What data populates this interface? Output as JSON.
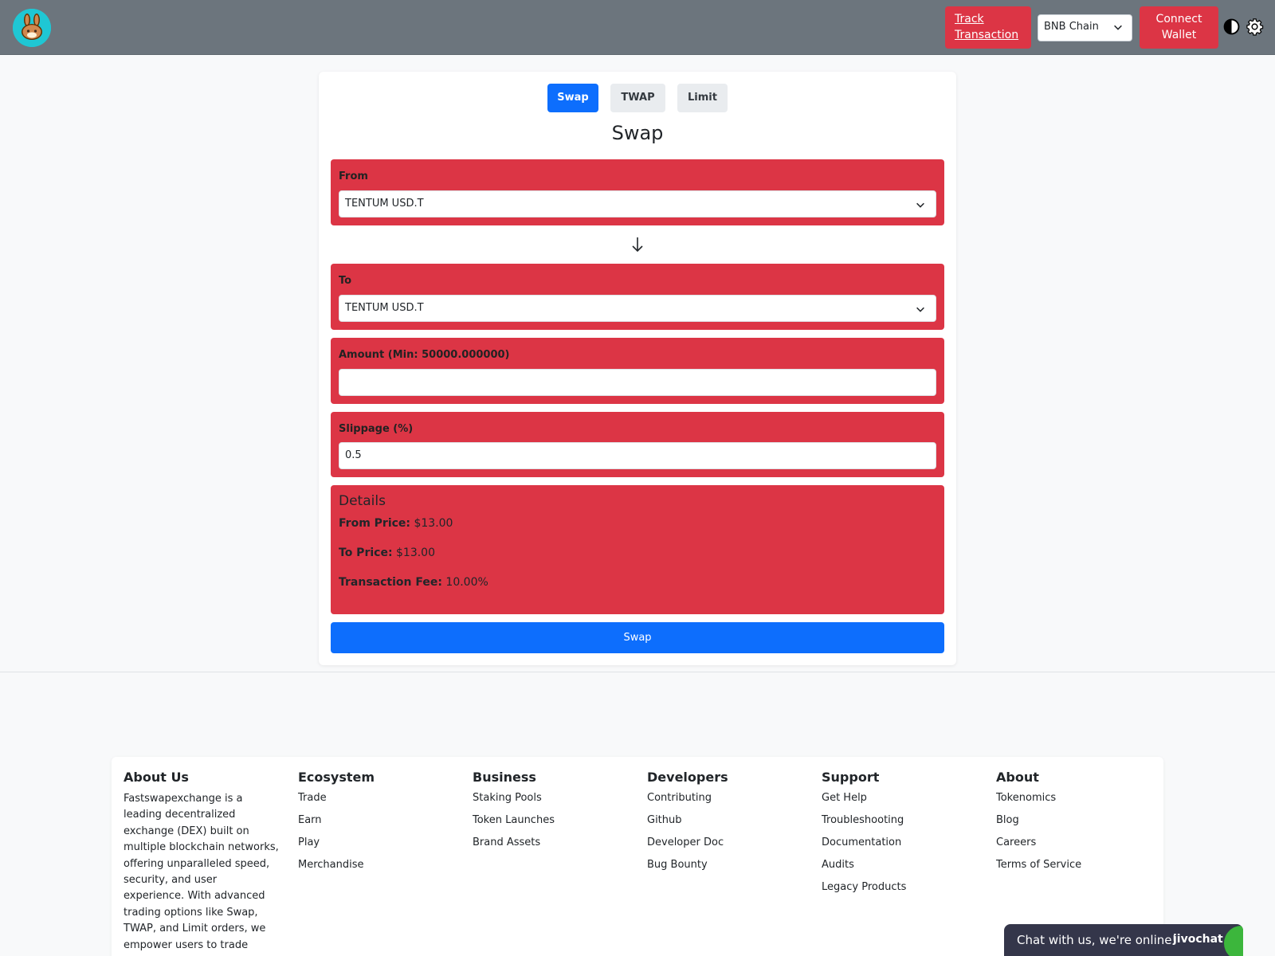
{
  "header": {
    "track_line1": "Track",
    "track_line2": "Transaction",
    "chain_selected": "BNB Chain",
    "connect_line1": "Connect",
    "connect_line2": "Wallet"
  },
  "tabs": {
    "swap": "Swap",
    "twap": "TWAP",
    "limit": "Limit"
  },
  "swap": {
    "title": "Swap",
    "from_label": "From",
    "from_value": "TENTUM USD.T",
    "to_label": "To",
    "to_value": "TENTUM USD.T",
    "amount_label": "Amount (Min: 50000.000000)",
    "amount_value": "",
    "slippage_label": "Slippage (%)",
    "slippage_value": "0.5",
    "details_title": "Details",
    "from_price_label": "From Price:",
    "from_price_value": "$13.00",
    "to_price_label": "To Price:",
    "to_price_value": "$13.00",
    "fee_label": "Transaction Fee:",
    "fee_value": "10.00%",
    "submit_label": "Swap"
  },
  "footer": {
    "about_title": "About Us",
    "about_text": "Fastswapexchange is a leading decentralized exchange (DEX) built on multiple blockchain networks, offering unparalleled speed, security, and user experience. With advanced trading options like Swap, TWAP, and Limit orders, we empower users to trade cryptocurrencies seamlessly",
    "ecosystem": {
      "title": "Ecosystem",
      "links": [
        "Trade",
        "Earn",
        "Play",
        "Merchandise"
      ]
    },
    "business": {
      "title": "Business",
      "links": [
        "Staking Pools",
        "Token Launches",
        "Brand Assets"
      ]
    },
    "developers": {
      "title": "Developers",
      "links": [
        "Contributing",
        "Github",
        "Developer Doc",
        "Bug Bounty"
      ]
    },
    "support": {
      "title": "Support",
      "links": [
        "Get Help",
        "Troubleshooting",
        "Documentation",
        "Audits",
        "Legacy Products"
      ]
    },
    "about": {
      "title": "About",
      "links": [
        "Tokenomics",
        "Blog",
        "Careers",
        "Terms of Service"
      ]
    }
  },
  "chat": {
    "text": "Chat with us, we're online!",
    "brand": "jivochat"
  },
  "colors": {
    "header": "#6c757d",
    "danger": "#dc3545",
    "primary": "#0d6efd",
    "logo": "#1fc7d4"
  }
}
